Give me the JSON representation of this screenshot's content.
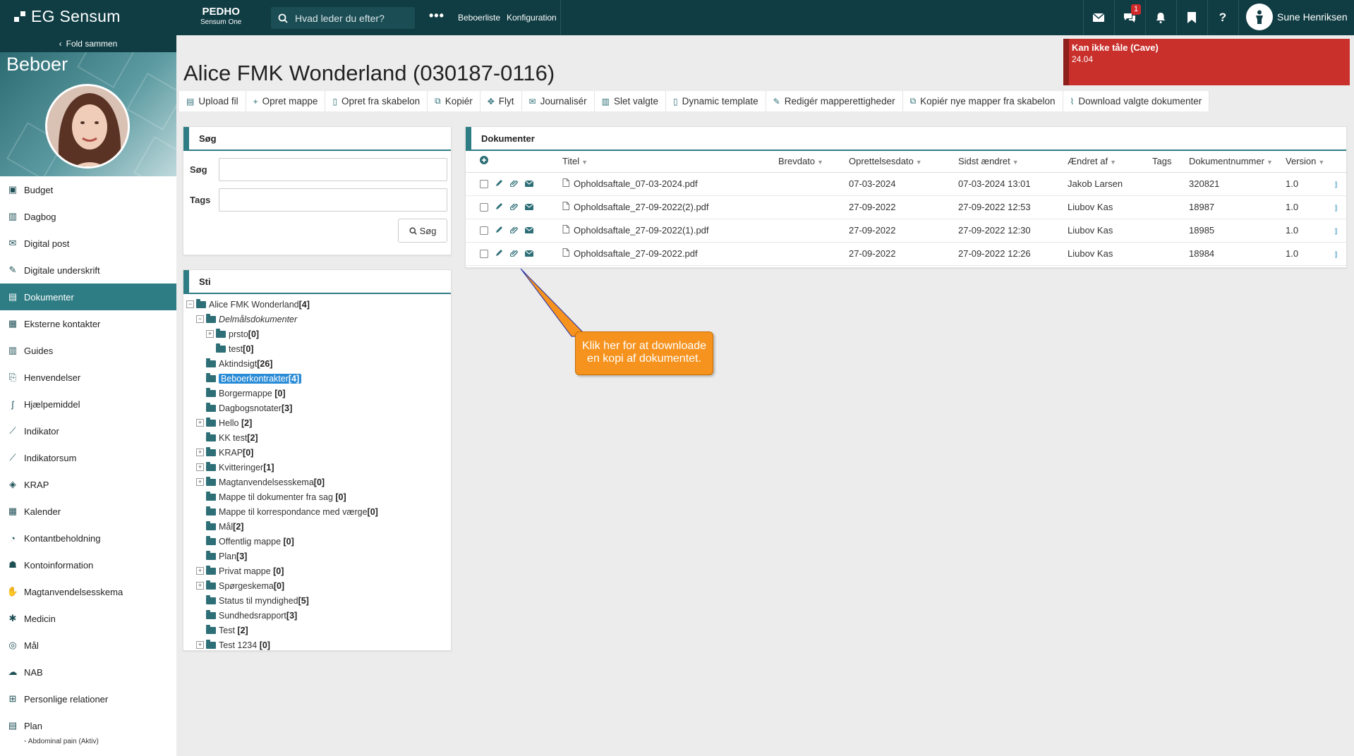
{
  "app": {
    "brand": "EG Sensum",
    "org": "PEDHO",
    "org_sub": "Sensum One"
  },
  "topbar": {
    "search_placeholder": "Hvad leder du efter?",
    "nav": [
      "Beboerliste",
      "Konfiguration"
    ],
    "notification_count": "1",
    "user_name": "Sune Henriksen"
  },
  "sidebar": {
    "fold_label": "Fold sammen",
    "hero_title": "Beboer",
    "items": [
      {
        "label": "Budget",
        "icon": "cube-icon"
      },
      {
        "label": "Dagbog",
        "icon": "book-icon"
      },
      {
        "label": "Digital post",
        "icon": "envelope-icon"
      },
      {
        "label": "Digitale underskrift",
        "icon": "signature-icon"
      },
      {
        "label": "Dokumenter",
        "icon": "document-icon",
        "active": true
      },
      {
        "label": "Eksterne kontakter",
        "icon": "contact-card-icon"
      },
      {
        "label": "Guides",
        "icon": "columns-icon"
      },
      {
        "label": "Henvendelser",
        "icon": "inquiry-icon"
      },
      {
        "label": "Hjælpemiddel",
        "icon": "cane-icon"
      },
      {
        "label": "Indikator",
        "icon": "line-chart-icon"
      },
      {
        "label": "Indikatorsum",
        "icon": "line-chart-icon"
      },
      {
        "label": "KRAP",
        "icon": "cubes-icon"
      },
      {
        "label": "Kalender",
        "icon": "calendar-icon"
      },
      {
        "label": "Kontantbeholdning",
        "icon": "piggy-bank-icon"
      },
      {
        "label": "Kontoinformation",
        "icon": "person-icon"
      },
      {
        "label": "Magtanvendelsesskema",
        "icon": "hand-icon"
      },
      {
        "label": "Medicin",
        "icon": "asterisk-icon"
      },
      {
        "label": "Mål",
        "icon": "target-icon"
      },
      {
        "label": "NAB",
        "icon": "cloud-upload-icon"
      },
      {
        "label": "Personlige relationer",
        "icon": "sitemap-icon"
      },
      {
        "label": "Plan",
        "icon": "clipboard-icon"
      }
    ],
    "plan_sub": "◦ Abdominal pain (Aktiv)"
  },
  "page": {
    "title": "Alice FMK Wonderland (030187-0116)",
    "alert_title": "Kan ikke tåle (Cave)",
    "alert_value": "24.04"
  },
  "toolbar": [
    {
      "label": "Upload fil",
      "icon": "upload-icon"
    },
    {
      "label": "Opret mappe",
      "icon": "plus-icon"
    },
    {
      "label": "Opret fra skabelon",
      "icon": "file-icon"
    },
    {
      "label": "Kopiér",
      "icon": "copy-icon"
    },
    {
      "label": "Flyt",
      "icon": "move-icon"
    },
    {
      "label": "Journalisér",
      "icon": "envelope-icon"
    },
    {
      "label": "Slet valgte",
      "icon": "trash-icon"
    },
    {
      "label": "Dynamic template",
      "icon": "file-icon"
    },
    {
      "label": "Redigér mapperettigheder",
      "icon": "pencil-icon"
    },
    {
      "label": "Kopiér nye mapper fra skabelon",
      "icon": "copy-icon"
    },
    {
      "label": "Download valgte dokumenter",
      "icon": "paperclip-icon"
    }
  ],
  "search_panel": {
    "title": "Søg",
    "search_label": "Søg",
    "tags_label": "Tags",
    "button_label": "Søg"
  },
  "path_panel": {
    "title": "Sti",
    "tree": [
      {
        "label": "Alice FMK Wonderland",
        "count": "[4]",
        "level": 0,
        "exp": "−"
      },
      {
        "label": "Delmålsdokumenter",
        "count": "",
        "level": 1,
        "exp": "−",
        "italic": true
      },
      {
        "label": "prsto",
        "count": "[0]",
        "level": 2,
        "exp": "+"
      },
      {
        "label": "test",
        "count": "[0]",
        "level": 2,
        "exp": ""
      },
      {
        "label": "Aktindsigt",
        "count": "[26]",
        "level": 1,
        "exp": ""
      },
      {
        "label": "Beboerkontrakter",
        "count": "[4]",
        "level": 1,
        "exp": "",
        "selected": true
      },
      {
        "label": "Borgermappe ",
        "count": "[0]",
        "level": 1,
        "exp": ""
      },
      {
        "label": "Dagbogsnotater",
        "count": "[3]",
        "level": 1,
        "exp": ""
      },
      {
        "label": "Hello ",
        "count": "[2]",
        "level": 1,
        "exp": "+"
      },
      {
        "label": "KK test",
        "count": "[2]",
        "level": 1,
        "exp": ""
      },
      {
        "label": "KRAP",
        "count": "[0]",
        "level": 1,
        "exp": "+"
      },
      {
        "label": "Kvitteringer",
        "count": "[1]",
        "level": 1,
        "exp": "+"
      },
      {
        "label": "Magtanvendelsesskema",
        "count": "[0]",
        "level": 1,
        "exp": "+"
      },
      {
        "label": "Mappe til dokumenter fra sag ",
        "count": "[0]",
        "level": 1,
        "exp": ""
      },
      {
        "label": "Mappe til korrespondance med værge",
        "count": "[0]",
        "level": 1,
        "exp": ""
      },
      {
        "label": "Mål",
        "count": "[2]",
        "level": 1,
        "exp": ""
      },
      {
        "label": "Offentlig mappe ",
        "count": "[0]",
        "level": 1,
        "exp": ""
      },
      {
        "label": "Plan",
        "count": "[3]",
        "level": 1,
        "exp": ""
      },
      {
        "label": "Privat mappe ",
        "count": "[0]",
        "level": 1,
        "exp": "+"
      },
      {
        "label": "Spørgeskema",
        "count": "[0]",
        "level": 1,
        "exp": "+"
      },
      {
        "label": "Status til myndighed",
        "count": "[5]",
        "level": 1,
        "exp": ""
      },
      {
        "label": "Sundhedsrapport",
        "count": "[3]",
        "level": 1,
        "exp": ""
      },
      {
        "label": "Test ",
        "count": "[2]",
        "level": 1,
        "exp": ""
      },
      {
        "label": "Test 1234 ",
        "count": "[0]",
        "level": 1,
        "exp": "+"
      }
    ]
  },
  "docs_panel": {
    "title": "Dokumenter",
    "columns": [
      "Titel",
      "Brevdato",
      "Oprettelsesdato",
      "Sidst ændret",
      "Ændret af",
      "Tags",
      "Dokumentnummer",
      "Version"
    ],
    "rows": [
      {
        "title": "Opholdsaftale_07-03-2024.pdf",
        "brevdato": "",
        "created": "07-03-2024",
        "modified": "07-03-2024 13:01",
        "by": "Jakob Larsen",
        "tags": "",
        "number": "320821",
        "version": "1.0"
      },
      {
        "title": "Opholdsaftale_27-09-2022(2).pdf",
        "brevdato": "",
        "created": "27-09-2022",
        "modified": "27-09-2022 12:53",
        "by": "Liubov Kas",
        "tags": "",
        "number": "18987",
        "version": "1.0"
      },
      {
        "title": "Opholdsaftale_27-09-2022(1).pdf",
        "brevdato": "",
        "created": "27-09-2022",
        "modified": "27-09-2022 12:30",
        "by": "Liubov Kas",
        "tags": "",
        "number": "18985",
        "version": "1.0"
      },
      {
        "title": "Opholdsaftale_27-09-2022.pdf",
        "brevdato": "",
        "created": "27-09-2022",
        "modified": "27-09-2022 12:26",
        "by": "Liubov Kas",
        "tags": "",
        "number": "18984",
        "version": "1.0"
      }
    ]
  },
  "tooltip": {
    "text1": "Klik her for at downloade",
    "text2": "en kopi af dokumentet."
  },
  "colors": {
    "topbar": "#0f3d43",
    "accent": "#2e7d84",
    "alert": "#c9302c",
    "tooltip": "#f6931e",
    "selected": "#2a8bd6"
  }
}
